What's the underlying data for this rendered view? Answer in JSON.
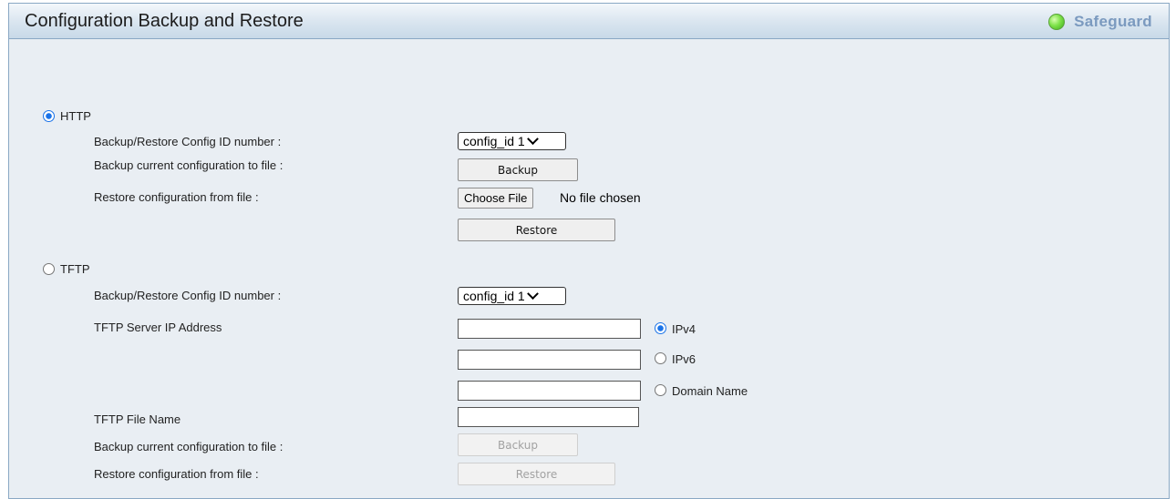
{
  "header": {
    "title": "Configuration Backup and Restore",
    "safeguard_label": "Safeguard",
    "safeguard_status_color": "#5cc52f"
  },
  "http": {
    "option_label": "HTTP",
    "selected": true,
    "config_id_label": "Backup/Restore Config ID number :",
    "config_id_value": "config_id 1",
    "backup_label": "Backup current configuration to file :",
    "backup_button": "Backup",
    "restore_label": "Restore configuration from file :",
    "choose_file_button": "Choose File",
    "no_file_text": "No file chosen",
    "restore_button": "Restore"
  },
  "tftp": {
    "option_label": "TFTP",
    "selected": false,
    "config_id_label": "Backup/Restore Config ID number :",
    "config_id_value": "config_id 1",
    "server_ip_label": "TFTP Server IP Address",
    "ipv4_label": "IPv4",
    "ipv6_label": "IPv6",
    "domain_label": "Domain Name",
    "file_name_label": "TFTP File Name",
    "backup_label": "Backup current configuration to file :",
    "backup_button": "Backup",
    "restore_label": "Restore configuration from file :",
    "restore_button": "Restore"
  }
}
